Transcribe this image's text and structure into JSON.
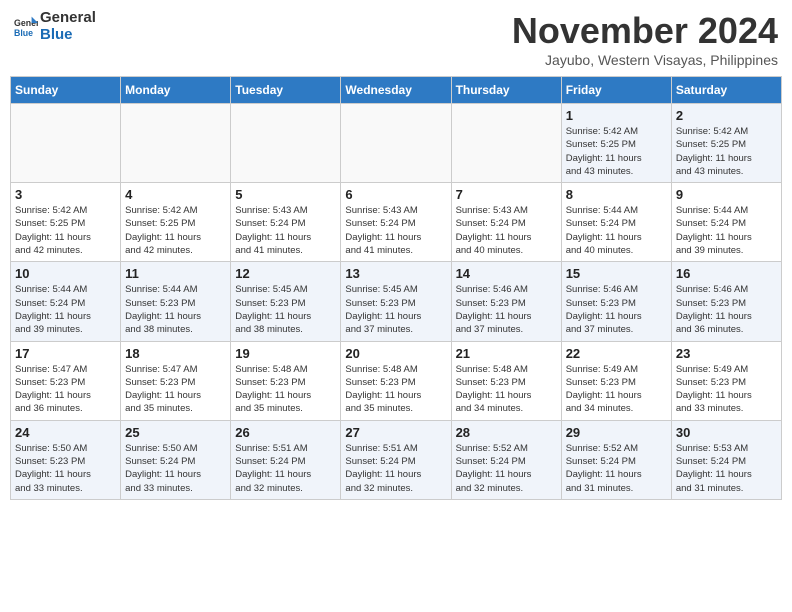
{
  "header": {
    "logo_general": "General",
    "logo_blue": "Blue",
    "month": "November 2024",
    "location": "Jayubo, Western Visayas, Philippines"
  },
  "days_of_week": [
    "Sunday",
    "Monday",
    "Tuesday",
    "Wednesday",
    "Thursday",
    "Friday",
    "Saturday"
  ],
  "weeks": [
    [
      {
        "day": "",
        "info": ""
      },
      {
        "day": "",
        "info": ""
      },
      {
        "day": "",
        "info": ""
      },
      {
        "day": "",
        "info": ""
      },
      {
        "day": "",
        "info": ""
      },
      {
        "day": "1",
        "info": "Sunrise: 5:42 AM\nSunset: 5:25 PM\nDaylight: 11 hours\nand 43 minutes."
      },
      {
        "day": "2",
        "info": "Sunrise: 5:42 AM\nSunset: 5:25 PM\nDaylight: 11 hours\nand 43 minutes."
      }
    ],
    [
      {
        "day": "3",
        "info": "Sunrise: 5:42 AM\nSunset: 5:25 PM\nDaylight: 11 hours\nand 42 minutes."
      },
      {
        "day": "4",
        "info": "Sunrise: 5:42 AM\nSunset: 5:25 PM\nDaylight: 11 hours\nand 42 minutes."
      },
      {
        "day": "5",
        "info": "Sunrise: 5:43 AM\nSunset: 5:24 PM\nDaylight: 11 hours\nand 41 minutes."
      },
      {
        "day": "6",
        "info": "Sunrise: 5:43 AM\nSunset: 5:24 PM\nDaylight: 11 hours\nand 41 minutes."
      },
      {
        "day": "7",
        "info": "Sunrise: 5:43 AM\nSunset: 5:24 PM\nDaylight: 11 hours\nand 40 minutes."
      },
      {
        "day": "8",
        "info": "Sunrise: 5:44 AM\nSunset: 5:24 PM\nDaylight: 11 hours\nand 40 minutes."
      },
      {
        "day": "9",
        "info": "Sunrise: 5:44 AM\nSunset: 5:24 PM\nDaylight: 11 hours\nand 39 minutes."
      }
    ],
    [
      {
        "day": "10",
        "info": "Sunrise: 5:44 AM\nSunset: 5:24 PM\nDaylight: 11 hours\nand 39 minutes."
      },
      {
        "day": "11",
        "info": "Sunrise: 5:44 AM\nSunset: 5:23 PM\nDaylight: 11 hours\nand 38 minutes."
      },
      {
        "day": "12",
        "info": "Sunrise: 5:45 AM\nSunset: 5:23 PM\nDaylight: 11 hours\nand 38 minutes."
      },
      {
        "day": "13",
        "info": "Sunrise: 5:45 AM\nSunset: 5:23 PM\nDaylight: 11 hours\nand 37 minutes."
      },
      {
        "day": "14",
        "info": "Sunrise: 5:46 AM\nSunset: 5:23 PM\nDaylight: 11 hours\nand 37 minutes."
      },
      {
        "day": "15",
        "info": "Sunrise: 5:46 AM\nSunset: 5:23 PM\nDaylight: 11 hours\nand 37 minutes."
      },
      {
        "day": "16",
        "info": "Sunrise: 5:46 AM\nSunset: 5:23 PM\nDaylight: 11 hours\nand 36 minutes."
      }
    ],
    [
      {
        "day": "17",
        "info": "Sunrise: 5:47 AM\nSunset: 5:23 PM\nDaylight: 11 hours\nand 36 minutes."
      },
      {
        "day": "18",
        "info": "Sunrise: 5:47 AM\nSunset: 5:23 PM\nDaylight: 11 hours\nand 35 minutes."
      },
      {
        "day": "19",
        "info": "Sunrise: 5:48 AM\nSunset: 5:23 PM\nDaylight: 11 hours\nand 35 minutes."
      },
      {
        "day": "20",
        "info": "Sunrise: 5:48 AM\nSunset: 5:23 PM\nDaylight: 11 hours\nand 35 minutes."
      },
      {
        "day": "21",
        "info": "Sunrise: 5:48 AM\nSunset: 5:23 PM\nDaylight: 11 hours\nand 34 minutes."
      },
      {
        "day": "22",
        "info": "Sunrise: 5:49 AM\nSunset: 5:23 PM\nDaylight: 11 hours\nand 34 minutes."
      },
      {
        "day": "23",
        "info": "Sunrise: 5:49 AM\nSunset: 5:23 PM\nDaylight: 11 hours\nand 33 minutes."
      }
    ],
    [
      {
        "day": "24",
        "info": "Sunrise: 5:50 AM\nSunset: 5:23 PM\nDaylight: 11 hours\nand 33 minutes."
      },
      {
        "day": "25",
        "info": "Sunrise: 5:50 AM\nSunset: 5:24 PM\nDaylight: 11 hours\nand 33 minutes."
      },
      {
        "day": "26",
        "info": "Sunrise: 5:51 AM\nSunset: 5:24 PM\nDaylight: 11 hours\nand 32 minutes."
      },
      {
        "day": "27",
        "info": "Sunrise: 5:51 AM\nSunset: 5:24 PM\nDaylight: 11 hours\nand 32 minutes."
      },
      {
        "day": "28",
        "info": "Sunrise: 5:52 AM\nSunset: 5:24 PM\nDaylight: 11 hours\nand 32 minutes."
      },
      {
        "day": "29",
        "info": "Sunrise: 5:52 AM\nSunset: 5:24 PM\nDaylight: 11 hours\nand 31 minutes."
      },
      {
        "day": "30",
        "info": "Sunrise: 5:53 AM\nSunset: 5:24 PM\nDaylight: 11 hours\nand 31 minutes."
      }
    ]
  ]
}
